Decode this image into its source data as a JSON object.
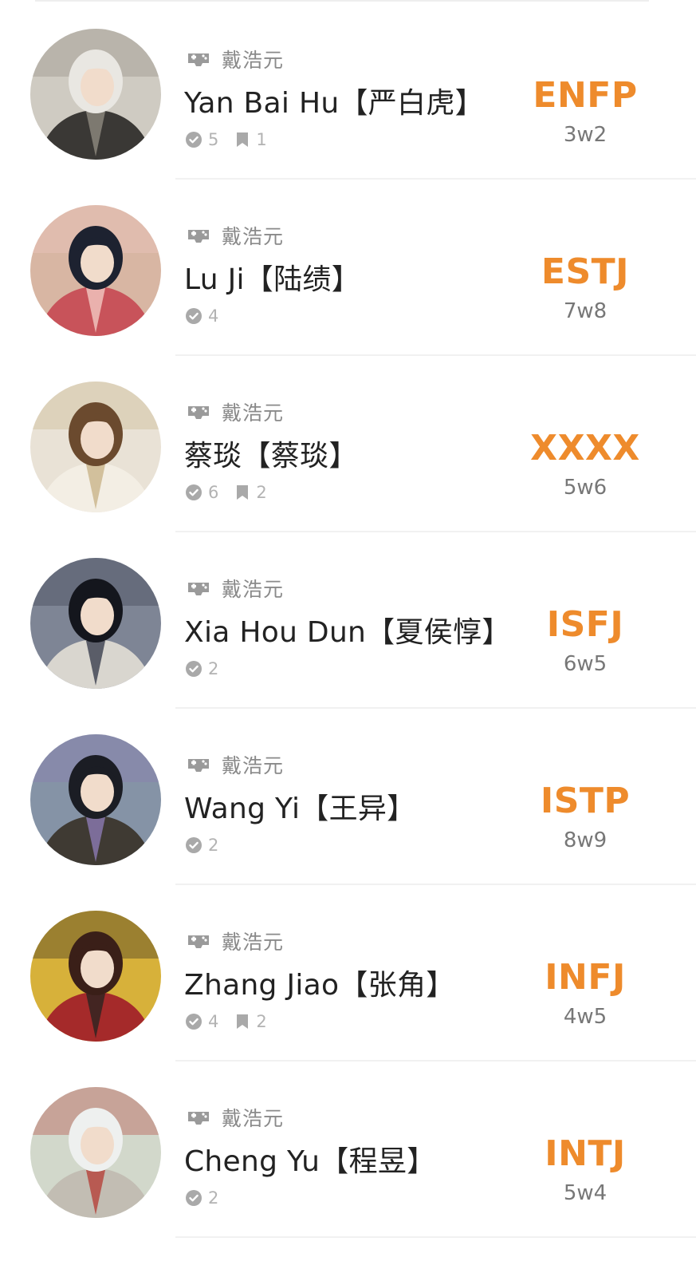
{
  "items": [
    {
      "game": "戴浩元",
      "name": "Yan Bai Hu【严白虎】",
      "mbti": "ENFP",
      "wing": "3w2",
      "votes": "5",
      "comments": "1",
      "avatar_colors": {
        "bg": "#cfcbc2",
        "hair": "#e9e7e2",
        "robe": "#3a3835",
        "accent": "#8f8a80"
      }
    },
    {
      "game": "戴浩元",
      "name": "Lu Ji【陆绩】",
      "mbti": "ESTJ",
      "wing": "7w8",
      "votes": "4",
      "comments": "",
      "avatar_colors": {
        "bg": "#d8b6a3",
        "hair": "#1d2230",
        "robe": "#c8535a",
        "accent": "#f2c9c2"
      }
    },
    {
      "game": "戴浩元",
      "name": "蔡琰【蔡琰】",
      "mbti": "XXXX",
      "wing": "5w6",
      "votes": "6",
      "comments": "2",
      "avatar_colors": {
        "bg": "#e9e2d6",
        "hair": "#6b4a2e",
        "robe": "#f3eee4",
        "accent": "#c9b48a"
      }
    },
    {
      "game": "戴浩元",
      "name": "Xia Hou Dun【夏侯惇】",
      "mbti": "ISFJ",
      "wing": "6w5",
      "votes": "2",
      "comments": "",
      "avatar_colors": {
        "bg": "#7e8595",
        "hair": "#14161d",
        "robe": "#d9d6cf",
        "accent": "#3a3f4d"
      }
    },
    {
      "game": "戴浩元",
      "name": "Wang Yi【王异】",
      "mbti": "ISTP",
      "wing": "8w9",
      "votes": "2",
      "comments": "",
      "avatar_colors": {
        "bg": "#8593a6",
        "hair": "#1b1d24",
        "robe": "#3f3a33",
        "accent": "#8c7bb3"
      }
    },
    {
      "game": "戴浩元",
      "name": "Zhang Jiao【张角】",
      "mbti": "INFJ",
      "wing": "4w5",
      "votes": "4",
      "comments": "2",
      "avatar_colors": {
        "bg": "#d7b13a",
        "hair": "#3a1f18",
        "robe": "#a52a2a",
        "accent": "#2b2420"
      }
    },
    {
      "game": "戴浩元",
      "name": "Cheng Yu【程昱】",
      "mbti": "INTJ",
      "wing": "5w4",
      "votes": "2",
      "comments": "",
      "avatar_colors": {
        "bg": "#d2d8cb",
        "hair": "#eef0ef",
        "robe": "#c2bdb3",
        "accent": "#b5413a"
      }
    }
  ],
  "colors": {
    "mbti": "#ee8b2c",
    "wing": "#777777",
    "meta": "#8a8a8a",
    "stat": "#b3b3b3",
    "name": "#222222"
  },
  "icons": {
    "meta": "gamepad-icon",
    "votes": "check-circle-icon",
    "comments": "bookmark-icon"
  }
}
